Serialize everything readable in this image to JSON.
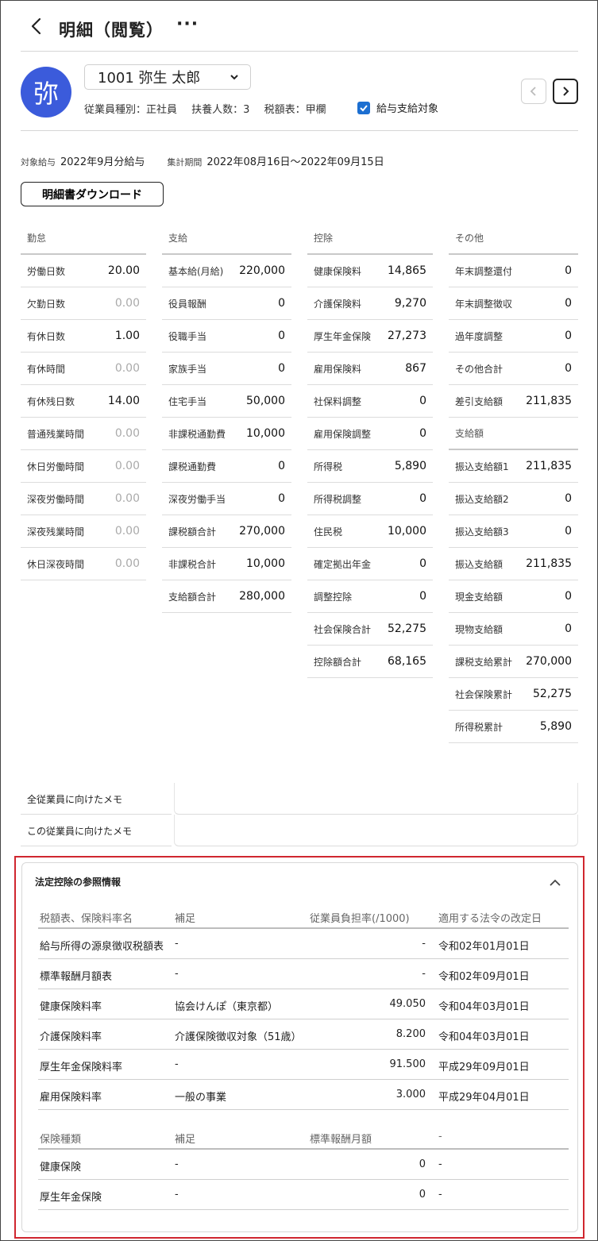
{
  "header": {
    "title": "明細（閲覧）",
    "more": "···"
  },
  "employee": {
    "avatar_char": "弥",
    "selector": "1001 弥生 太郎",
    "type": "従業員種別：正社員",
    "dependents": "扶養人数：3",
    "tax_table": "税額表：甲欄",
    "payment_target_label": "給与支給対象",
    "payment_target_checked": true
  },
  "period": {
    "target_label": "対象給与",
    "target_value": "2022年9月分給与",
    "range_label": "集計期間",
    "range_value": "2022年08月16日〜2022年09月15日"
  },
  "download_label": "明細書ダウンロード",
  "attendance": {
    "header": "勤怠",
    "rows": [
      {
        "label": "労働日数",
        "value": "20.00"
      },
      {
        "label": "欠勤日数",
        "value": "0.00"
      },
      {
        "label": "有休日数",
        "value": "1.00"
      },
      {
        "label": "有休時間",
        "value": "0.00"
      },
      {
        "label": "有休残日数",
        "value": "14.00"
      },
      {
        "label": "普通残業時間",
        "value": "0.00"
      },
      {
        "label": "休日労働時間",
        "value": "0.00"
      },
      {
        "label": "深夜労働時間",
        "value": "0.00"
      },
      {
        "label": "深夜残業時間",
        "value": "0.00"
      },
      {
        "label": "休日深夜時間",
        "value": "0.00"
      }
    ]
  },
  "payment": {
    "header": "支給",
    "rows": [
      {
        "label": "基本給(月給)",
        "value": "220,000"
      },
      {
        "label": "役員報酬",
        "value": "0"
      },
      {
        "label": "役職手当",
        "value": "0"
      },
      {
        "label": "家族手当",
        "value": "0"
      },
      {
        "label": "住宅手当",
        "value": "50,000"
      },
      {
        "label": "非課税通勤費",
        "value": "10,000"
      },
      {
        "label": "課税通勤費",
        "value": "0"
      },
      {
        "label": "深夜労働手当",
        "value": "0"
      },
      {
        "label": "課税額合計",
        "value": "270,000"
      },
      {
        "label": "非課税合計",
        "value": "10,000"
      },
      {
        "label": "支給額合計",
        "value": "280,000"
      }
    ]
  },
  "deduction": {
    "header": "控除",
    "rows": [
      {
        "label": "健康保険料",
        "value": "14,865"
      },
      {
        "label": "介護保険料",
        "value": "9,270"
      },
      {
        "label": "厚生年金保険",
        "value": "27,273"
      },
      {
        "label": "雇用保険料",
        "value": "867"
      },
      {
        "label": "社保料調整",
        "value": "0"
      },
      {
        "label": "雇用保険調整",
        "value": "0"
      },
      {
        "label": "所得税",
        "value": "5,890"
      },
      {
        "label": "所得税調整",
        "value": "0"
      },
      {
        "label": "住民税",
        "value": "10,000"
      },
      {
        "label": "確定拠出年金",
        "value": "0"
      },
      {
        "label": "調整控除",
        "value": "0"
      },
      {
        "label": "社会保険合計",
        "value": "52,275"
      },
      {
        "label": "控除額合計",
        "value": "68,165"
      }
    ]
  },
  "other": {
    "header": "その他",
    "rows": [
      {
        "label": "年末調整還付",
        "value": "0"
      },
      {
        "label": "年末調整徴収",
        "value": "0"
      },
      {
        "label": "過年度調整",
        "value": "0"
      },
      {
        "label": "その他合計",
        "value": "0"
      },
      {
        "label": "差引支給額",
        "value": "211,835"
      }
    ],
    "sub_header": "支給額",
    "sub_rows": [
      {
        "label": "振込支給額1",
        "value": "211,835"
      },
      {
        "label": "振込支給額2",
        "value": "0"
      },
      {
        "label": "振込支給額3",
        "value": "0"
      },
      {
        "label": "振込支給額",
        "value": "211,835"
      },
      {
        "label": "現金支給額",
        "value": "0"
      },
      {
        "label": "現物支給額",
        "value": "0"
      },
      {
        "label": "課税支給累計",
        "value": "270,000"
      },
      {
        "label": "社会保険累計",
        "value": "52,275"
      },
      {
        "label": "所得税累計",
        "value": "5,890"
      }
    ]
  },
  "memos": {
    "all": "全従業員に向けたメモ",
    "this": "この従業員に向けたメモ"
  },
  "statutory": {
    "title": "法定控除の参照情報",
    "rates_headers": [
      "税額表、保険料率名",
      "補足",
      "従業員負担率(/1000)",
      "適用する法令の改定日"
    ],
    "rates": [
      {
        "name": "給与所得の源泉徴収税額表",
        "note": "-",
        "rate": "-",
        "date": "令和02年01月01日"
      },
      {
        "name": "標準報酬月額表",
        "note": "-",
        "rate": "-",
        "date": "令和02年09月01日"
      },
      {
        "name": "健康保険料率",
        "note": "協会けんぽ（東京都）",
        "rate": "49.050",
        "date": "令和04年03月01日"
      },
      {
        "name": "介護保険料率",
        "note": "介護保険徴収対象（51歳）",
        "rate": "8.200",
        "date": "令和04年03月01日"
      },
      {
        "name": "厚生年金保険料率",
        "note": "-",
        "rate": "91.500",
        "date": "平成29年09月01日"
      },
      {
        "name": "雇用保険料率",
        "note": "一般の事業",
        "rate": "3.000",
        "date": "平成29年04月01日"
      }
    ],
    "ins_headers": [
      "保険種類",
      "補足",
      "標準報酬月額",
      "-"
    ],
    "insurance": [
      {
        "type": "健康保険",
        "note": "-",
        "amount": "0",
        "extra": "-"
      },
      {
        "type": "厚生年金保険",
        "note": "-",
        "amount": "0",
        "extra": "-"
      }
    ]
  }
}
